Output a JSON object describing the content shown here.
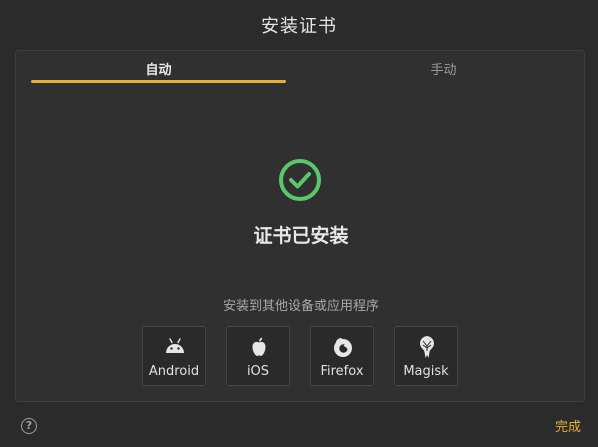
{
  "dialog": {
    "title": "安装证书",
    "tabs": [
      {
        "label": "自动",
        "active": true
      },
      {
        "label": "手动",
        "active": false
      }
    ],
    "status_text": "证书已安装",
    "status_icon": "check-circle-icon",
    "install_other_text": "安装到其他设备或应用程序",
    "targets": [
      {
        "label": "Android",
        "icon": "android-icon"
      },
      {
        "label": "iOS",
        "icon": "apple-icon"
      },
      {
        "label": "Firefox",
        "icon": "firefox-icon"
      },
      {
        "label": "Magisk",
        "icon": "magisk-icon"
      }
    ],
    "help_symbol": "?",
    "done_label": "完成"
  },
  "colors": {
    "accent": "#e6b037",
    "success": "#5cc66a",
    "background": "#2b2b2b",
    "panel": "#303030"
  }
}
